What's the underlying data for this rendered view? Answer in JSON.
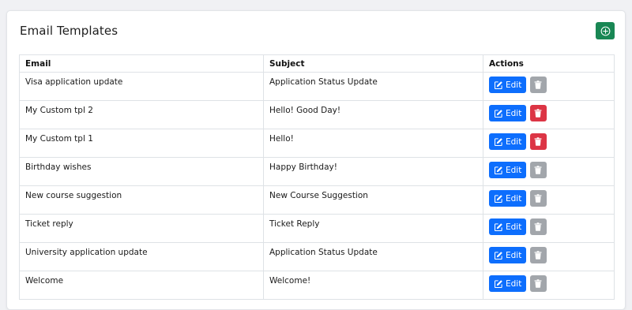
{
  "page": {
    "title": "Email Templates",
    "add_icon": "plus-circle-icon",
    "add_color": "#198754"
  },
  "table": {
    "headers": [
      "Email",
      "Subject",
      "Actions"
    ],
    "edit_label": "Edit",
    "edit_icon": "edit-icon",
    "delete_icon": "trash-icon",
    "colors": {
      "edit": "#0d6efd",
      "delete_enabled": "#dc3545",
      "delete_disabled": "#a2a6ab"
    },
    "rows": [
      {
        "email": "Visa application update",
        "subject": "Application Status Update",
        "delete_enabled": false
      },
      {
        "email": "My Custom tpl 2",
        "subject": "Hello! Good Day!",
        "delete_enabled": true
      },
      {
        "email": "My Custom tpl 1",
        "subject": "Hello!",
        "delete_enabled": true
      },
      {
        "email": "Birthday wishes",
        "subject": "Happy Birthday!",
        "delete_enabled": false
      },
      {
        "email": "New course suggestion",
        "subject": "New Course Suggestion",
        "delete_enabled": false
      },
      {
        "email": "Ticket reply",
        "subject": "Ticket Reply",
        "delete_enabled": false
      },
      {
        "email": "University application update",
        "subject": "Application Status Update",
        "delete_enabled": false
      },
      {
        "email": "Welcome",
        "subject": "Welcome!",
        "delete_enabled": false
      }
    ]
  }
}
